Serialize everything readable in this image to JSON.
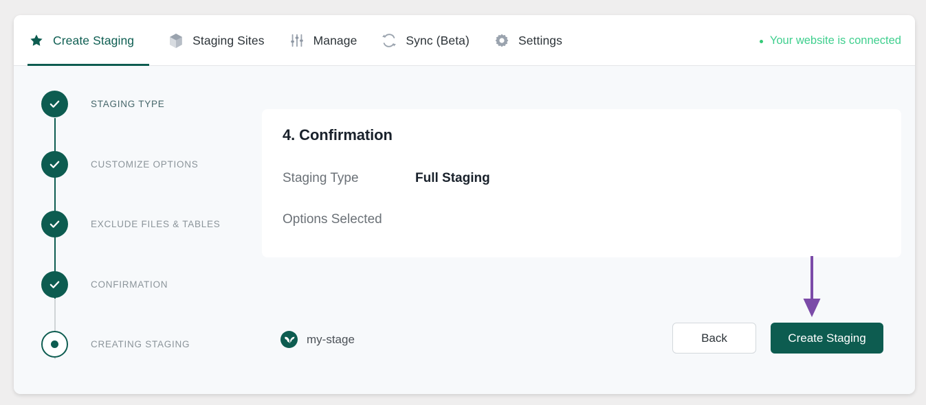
{
  "nav": {
    "tabs": [
      {
        "label": "Create Staging",
        "icon": "star-icon",
        "active": true
      },
      {
        "label": "Staging Sites",
        "icon": "cube-icon",
        "active": false
      },
      {
        "label": "Manage",
        "icon": "sliders-icon",
        "active": false
      },
      {
        "label": "Sync (Beta)",
        "icon": "sync-icon",
        "active": false
      },
      {
        "label": "Settings",
        "icon": "gear-icon",
        "active": false
      }
    ],
    "status": {
      "text": "Your website is connected",
      "dot_color": "#35c978",
      "text_color": "#3fcf8e"
    }
  },
  "stepper": {
    "steps": [
      {
        "label": "STAGING TYPE",
        "state": "done"
      },
      {
        "label": "CUSTOMIZE OPTIONS",
        "state": "done"
      },
      {
        "label": "EXCLUDE FILES & TABLES",
        "state": "done"
      },
      {
        "label": "CONFIRMATION",
        "state": "done"
      },
      {
        "label": "CREATING STAGING",
        "state": "current"
      }
    ]
  },
  "card": {
    "title": "4. Confirmation",
    "rows": [
      {
        "key": "Staging Type",
        "value": "Full Staging"
      },
      {
        "key": "Options Selected",
        "value": ""
      }
    ]
  },
  "actions": {
    "site_name": "my-stage",
    "site_icon": "wpstaging-logo-icon",
    "back_label": "Back",
    "create_label": "Create Staging"
  },
  "annotation": {
    "arrow_color": "#7b4ba8",
    "points_to": "Create Staging"
  },
  "theme": {
    "accent": "#0d5c50",
    "page_bg": "#efeeee",
    "content_bg": "#f7f9fb"
  }
}
